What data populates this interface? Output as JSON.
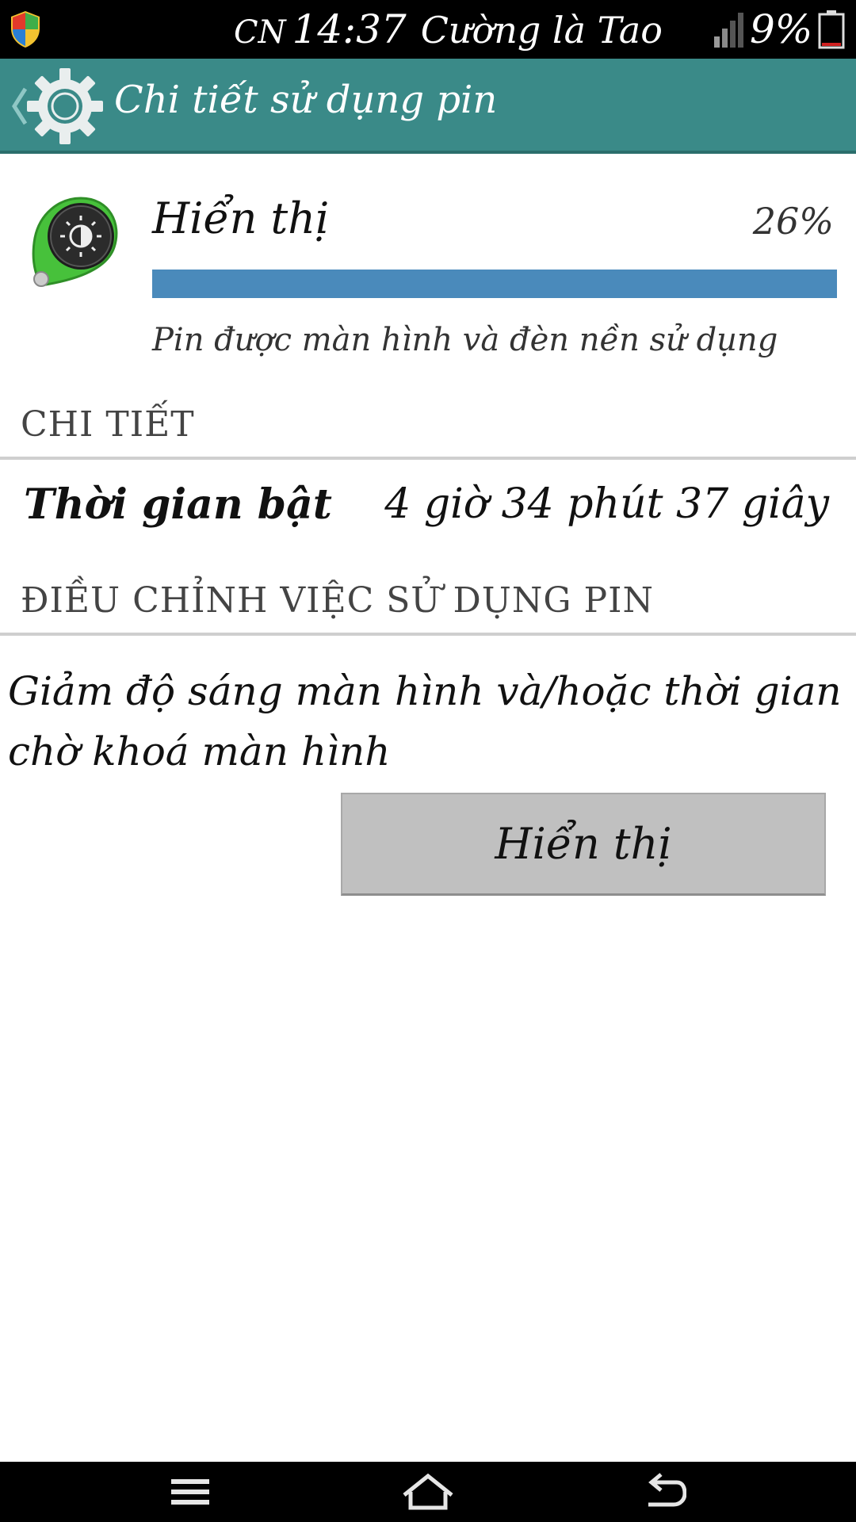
{
  "status_bar": {
    "day": "CN",
    "time": "14:37",
    "carrier": "Cường là Tao",
    "battery_text": "9%",
    "battery_level": 0.09,
    "icons": [
      "shield-icon",
      "signal-icon",
      "battery-icon"
    ]
  },
  "action_bar": {
    "title": "Chi tiết sử dụng pin",
    "icons": [
      "back-icon",
      "gear-icon"
    ]
  },
  "app": {
    "name": "Hiển thị",
    "percent_text": "26%",
    "usage_fraction": 1.0,
    "description": "Pin được màn hình và đèn nền sử dụng",
    "icon": "display-brightness-icon"
  },
  "details": {
    "header": "CHI TIẾT",
    "on_time_label": "Thời gian bật",
    "on_time_value": "4 giờ 34 phút 37 giây"
  },
  "adjust": {
    "header": "ĐIỀU CHỈNH VIỆC SỬ DỤNG PIN",
    "advice": "Giảm độ sáng màn hình và/hoặc thời gian chờ khoá màn hình",
    "button_label": "Hiển thị"
  },
  "nav_bar": {
    "icons": [
      "menu-icon",
      "home-icon",
      "back-nav-icon"
    ]
  },
  "colors": {
    "action_bar": "#3a8a88",
    "usage_bar": "#4a8abb",
    "button": "#c0c0c0",
    "battery_low": "#d02020"
  }
}
